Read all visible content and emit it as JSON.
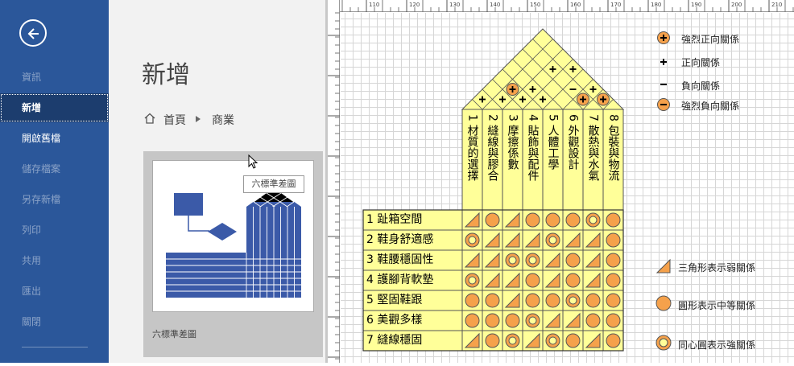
{
  "sidebar": {
    "back_icon": "arrow-left-circle-icon",
    "items": [
      {
        "label": "資訊",
        "enabled": false
      },
      {
        "label": "新增",
        "enabled": true,
        "active": true
      },
      {
        "label": "開啟舊檔",
        "enabled": true
      },
      {
        "label": "儲存檔案",
        "enabled": false
      },
      {
        "label": "另存新檔",
        "enabled": false
      },
      {
        "label": "列印",
        "enabled": false
      },
      {
        "label": "共用",
        "enabled": false
      },
      {
        "label": "匯出",
        "enabled": false
      },
      {
        "label": "關閉",
        "enabled": false
      }
    ]
  },
  "backstage": {
    "title": "新增",
    "breadcrumb": {
      "home": "首頁",
      "current": "商業"
    },
    "template": {
      "name": "六標準差圖",
      "tooltip": "六標準差圖"
    }
  },
  "ruler": {
    "top_labels": [
      "110",
      "120",
      "130",
      "140",
      "150",
      "160",
      "170",
      "180",
      "190",
      "200",
      "210"
    ]
  },
  "diagram": {
    "characteristics": [
      "1 材質的選擇",
      "2 縫線與膠合",
      "3 摩擦係數",
      "4 貼飾與配件",
      "5 人體工學",
      "6 外觀設計",
      "7 散熱與水氣",
      "8 包裝與物流"
    ],
    "requirements": [
      "1 趾箱空間",
      "2 鞋身舒適感",
      "3 鞋腰穩固性",
      "4 護腳背軟墊",
      "5 堅固鞋跟",
      "6 美觀多樣",
      "7 縫線穩固"
    ],
    "relationships": [
      [
        "weak",
        "medium",
        "weak",
        "medium",
        "medium",
        "medium",
        "strong",
        "medium"
      ],
      [
        "strong",
        "weak",
        "weak",
        "weak",
        "strong",
        "weak",
        "weak",
        "medium"
      ],
      [
        "weak",
        "weak",
        "strong",
        "strong",
        "weak",
        "medium",
        "weak",
        "medium"
      ],
      [
        "strong",
        "weak",
        "weak",
        "medium",
        "weak",
        "medium",
        "weak",
        "medium"
      ],
      [
        "medium",
        "medium",
        "weak",
        "medium",
        "medium",
        "strong",
        "medium",
        "medium"
      ],
      [
        "medium",
        "medium",
        "medium",
        "strong",
        "weak",
        "weak",
        "medium",
        "medium"
      ],
      [
        "weak",
        "medium",
        "strong",
        "weak",
        "strong",
        "medium",
        "weak",
        "medium"
      ]
    ],
    "roof_symbols": [
      {
        "i": 1,
        "j": 2,
        "s": "positive"
      },
      {
        "i": 2,
        "j": 3,
        "s": "positive"
      },
      {
        "i": 2,
        "j": 4,
        "s": "strong-positive"
      },
      {
        "i": 4,
        "j": 5,
        "s": "positive"
      },
      {
        "i": 6,
        "j": 7,
        "s": "strong-positive"
      },
      {
        "i": 3,
        "j": 7,
        "s": "positive"
      },
      {
        "i": 4,
        "j": 8,
        "s": "positive"
      },
      {
        "i": 5,
        "j": 7,
        "s": "negative"
      },
      {
        "i": 3,
        "j": 5,
        "s": "positive"
      },
      {
        "i": 6,
        "j": 8,
        "s": "positive"
      },
      {
        "i": 7,
        "j": 8,
        "s": "strong-negative"
      },
      {
        "i": 3,
        "j": 4,
        "s": "positive"
      },
      {
        "i": 7,
        "j": 8,
        "s": "positive"
      }
    ],
    "colors": {
      "cell": "#ffff99",
      "orange": "#f5a14b",
      "line": "#555555"
    }
  },
  "legend_top": [
    {
      "icon": "strong-positive-icon",
      "label": "強烈正向關係"
    },
    {
      "icon": "positive-icon",
      "label": "正向關係"
    },
    {
      "icon": "negative-icon",
      "label": "負向關係"
    },
    {
      "icon": "strong-negative-icon",
      "label": "強烈負向關係"
    }
  ],
  "legend_bottom": [
    {
      "icon": "triangle-icon",
      "label": "三角形表示弱關係"
    },
    {
      "icon": "circle-icon",
      "label": "圓形表示中等關係"
    },
    {
      "icon": "concentric-circle-icon",
      "label": "同心圓表示強關係"
    }
  ]
}
